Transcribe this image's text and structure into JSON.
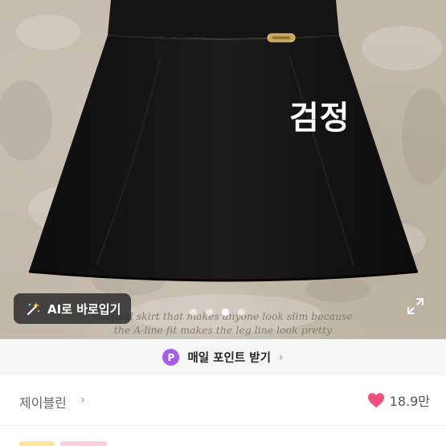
{
  "product_image": {
    "color_label": "검정",
    "caption_line1": "magical skirt that makes anyone look slim because",
    "caption_line2": "the A-line fit makes the leg line look pretty",
    "slide_count": 4,
    "active_slide": 3
  },
  "ai_button": {
    "label": "AI로 바로입기",
    "icon": "magic-wand-icon"
  },
  "expand_button": {
    "icon": "expand-icon"
  },
  "point_banner": {
    "badge": "P",
    "label": "매일 포인트 받기",
    "icon": "chevron-right-icon"
  },
  "shop": {
    "name": "제이블린",
    "chevron": "›"
  },
  "likes": {
    "count": "18.9만",
    "icon": "heart-icon",
    "color": "#f0507a"
  },
  "colors": {
    "point_purple": "#a45ee5",
    "skirt": "#131313"
  }
}
